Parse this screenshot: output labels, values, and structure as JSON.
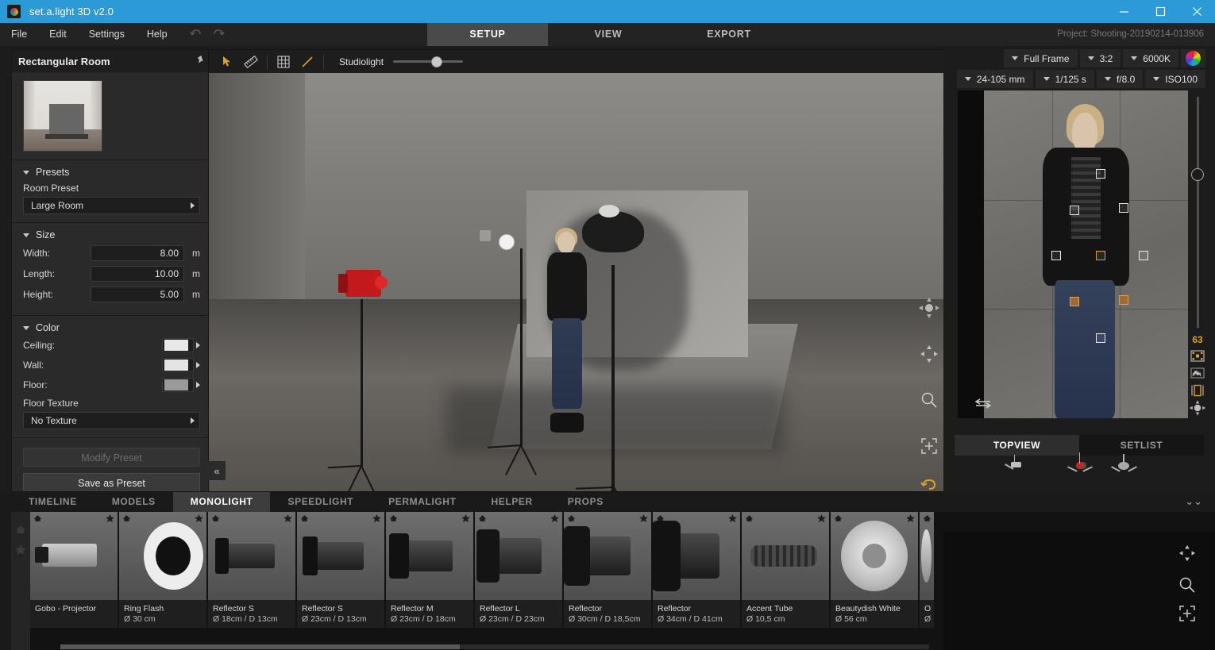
{
  "window": {
    "title": "set.a.light 3D v2.0",
    "logo_icon": "app-logo-icon",
    "minimize": "—",
    "maximize": "☐",
    "close": "✕"
  },
  "menubar": {
    "items": [
      "File",
      "Edit",
      "Settings",
      "Help"
    ],
    "undo_icon": "undo-icon",
    "redo_icon": "redo-icon",
    "modes": [
      {
        "label": "SETUP",
        "active": true
      },
      {
        "label": "VIEW",
        "active": false
      },
      {
        "label": "EXPORT",
        "active": false
      }
    ],
    "project": "Project: Shooting-20190214-013906"
  },
  "left_panel": {
    "title": "Rectangular Room",
    "pin_icon": "pin-icon",
    "thumbnail": "room-preview-thumbnail",
    "presets": {
      "section_label": "Presets",
      "field_label": "Room Preset",
      "value": "Large Room"
    },
    "size": {
      "section_label": "Size",
      "fields": [
        {
          "label": "Width:",
          "value": "8.00",
          "unit": "m"
        },
        {
          "label": "Length:",
          "value": "10.00",
          "unit": "m"
        },
        {
          "label": "Height:",
          "value": "5.00",
          "unit": "m"
        }
      ]
    },
    "color": {
      "section_label": "Color",
      "rows": [
        {
          "label": "Ceiling:",
          "swatch": "#e8e8e8"
        },
        {
          "label": "Wall:",
          "swatch": "#e4e4e4"
        },
        {
          "label": "Floor:",
          "swatch": "#9a9a9a"
        }
      ],
      "texture_label": "Floor Texture",
      "texture_value": "No Texture"
    },
    "modify_preset": "Modify Preset",
    "save_preset": "Save as Preset"
  },
  "viewport": {
    "tools": [
      {
        "icon": "select-cursor-icon",
        "active": true
      },
      {
        "icon": "ruler-icon",
        "active": false
      },
      {
        "icon": "grid-icon",
        "active": false
      },
      {
        "icon": "line-measure-icon",
        "active": true
      }
    ],
    "studiolight_label": "Studiolight",
    "studiolight_value": 54,
    "controls": [
      {
        "icon": "orbit-navigation-icon"
      },
      {
        "icon": "pan-move-icon"
      },
      {
        "icon": "zoom-magnifier-icon"
      },
      {
        "icon": "fit-to-frame-icon"
      },
      {
        "icon": "reset-view-icon"
      }
    ],
    "collapse_icon": "collapse-left-icon"
  },
  "camera": {
    "row1": [
      {
        "label": "Full Frame",
        "name": "sensor-format-select"
      },
      {
        "label": "3:2",
        "name": "aspect-ratio-select"
      },
      {
        "label": "6000K",
        "name": "white-balance-select"
      }
    ],
    "color_wheel_icon": "color-wheel-icon",
    "row2": [
      {
        "label": "24-105 mm",
        "name": "focal-length-select"
      },
      {
        "label": "1/125 s",
        "name": "shutter-speed-select"
      },
      {
        "label": "f/8.0",
        "name": "aperture-select"
      },
      {
        "label": "ISO100",
        "name": "iso-select"
      }
    ]
  },
  "preview": {
    "exposure_value": "63",
    "rail_icons": [
      "light-meter-points-icon",
      "histogram-icon",
      "crop-frame-icon",
      "orbit-navigation-icon"
    ],
    "swap_icon": "swap-view-icon",
    "brightness_slider": 31
  },
  "right_tabs": [
    {
      "label": "TOPVIEW",
      "active": true
    },
    {
      "label": "SETLIST",
      "active": false
    }
  ],
  "topview": {
    "controls": [
      "pan-move-icon",
      "zoom-magnifier-icon",
      "fit-to-frame-icon"
    ]
  },
  "bottom_tabs": [
    {
      "label": "TIMELINE",
      "active": false
    },
    {
      "label": "MODELS",
      "active": false
    },
    {
      "label": "MONOLIGHT",
      "active": true
    },
    {
      "label": "SPEEDLIGHT",
      "active": false
    },
    {
      "label": "PERMALIGHT",
      "active": false
    },
    {
      "label": "HELPER",
      "active": false
    },
    {
      "label": "PROPS",
      "active": false
    }
  ],
  "bottom_collapse_icon": "chevron-double-down-icon",
  "library_rail": [
    "home-icon",
    "star-icon"
  ],
  "library_items": [
    {
      "name": "Gobo - Projector",
      "spec": ""
    },
    {
      "name": "Ring Flash",
      "spec": "Ø 30 cm"
    },
    {
      "name": "Reflector S",
      "spec": "Ø 18cm / D 13cm"
    },
    {
      "name": "Reflector S",
      "spec": "Ø 23cm / D 13cm"
    },
    {
      "name": "Reflector M",
      "spec": "Ø 23cm / D 18cm"
    },
    {
      "name": "Reflector L",
      "spec": "Ø 23cm / D 23cm"
    },
    {
      "name": "Reflector",
      "spec": "Ø 30cm / D 18,5cm"
    },
    {
      "name": "Reflector",
      "spec": "Ø 34cm / D 41cm"
    },
    {
      "name": "Accent Tube",
      "spec": "Ø 10,5 cm"
    },
    {
      "name": "Beautydish White",
      "spec": "Ø 56 cm"
    },
    {
      "name": "O",
      "spec": "Ø"
    }
  ],
  "colors": {
    "accent": "#2b9ad6",
    "highlight": "#e0a020",
    "panel": "#2a2a2a"
  }
}
